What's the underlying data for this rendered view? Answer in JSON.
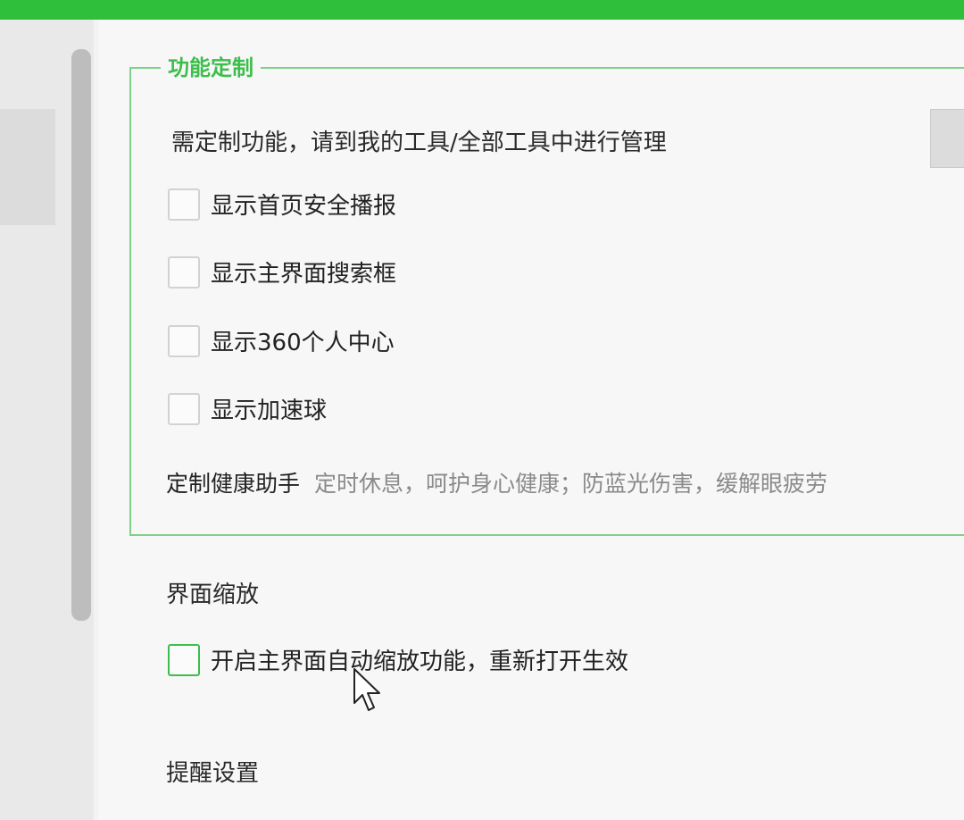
{
  "group": {
    "title": "功能定制",
    "hint": "需定制功能，请到我的工具/全部工具中进行管理",
    "options": [
      {
        "label": "显示首页安全播报",
        "checked": false
      },
      {
        "label": "显示主界面搜索框",
        "checked": false
      },
      {
        "label": "显示360个人中心",
        "checked": false
      },
      {
        "label": "显示加速球",
        "checked": false
      }
    ],
    "health": {
      "label": "定制健康助手",
      "desc": "定时休息，呵护身心健康；防蓝光伤害，缓解眼疲劳"
    }
  },
  "zoom": {
    "title": "界面缩放",
    "option_label": "开启主界面自动缩放功能，重新打开生效",
    "checked": false
  },
  "reminder": {
    "title": "提醒设置"
  },
  "colors": {
    "accent": "#3cbf4a",
    "topbar": "#2fbf3a"
  },
  "icons": {
    "cursor": "mouse-pointer-icon"
  }
}
